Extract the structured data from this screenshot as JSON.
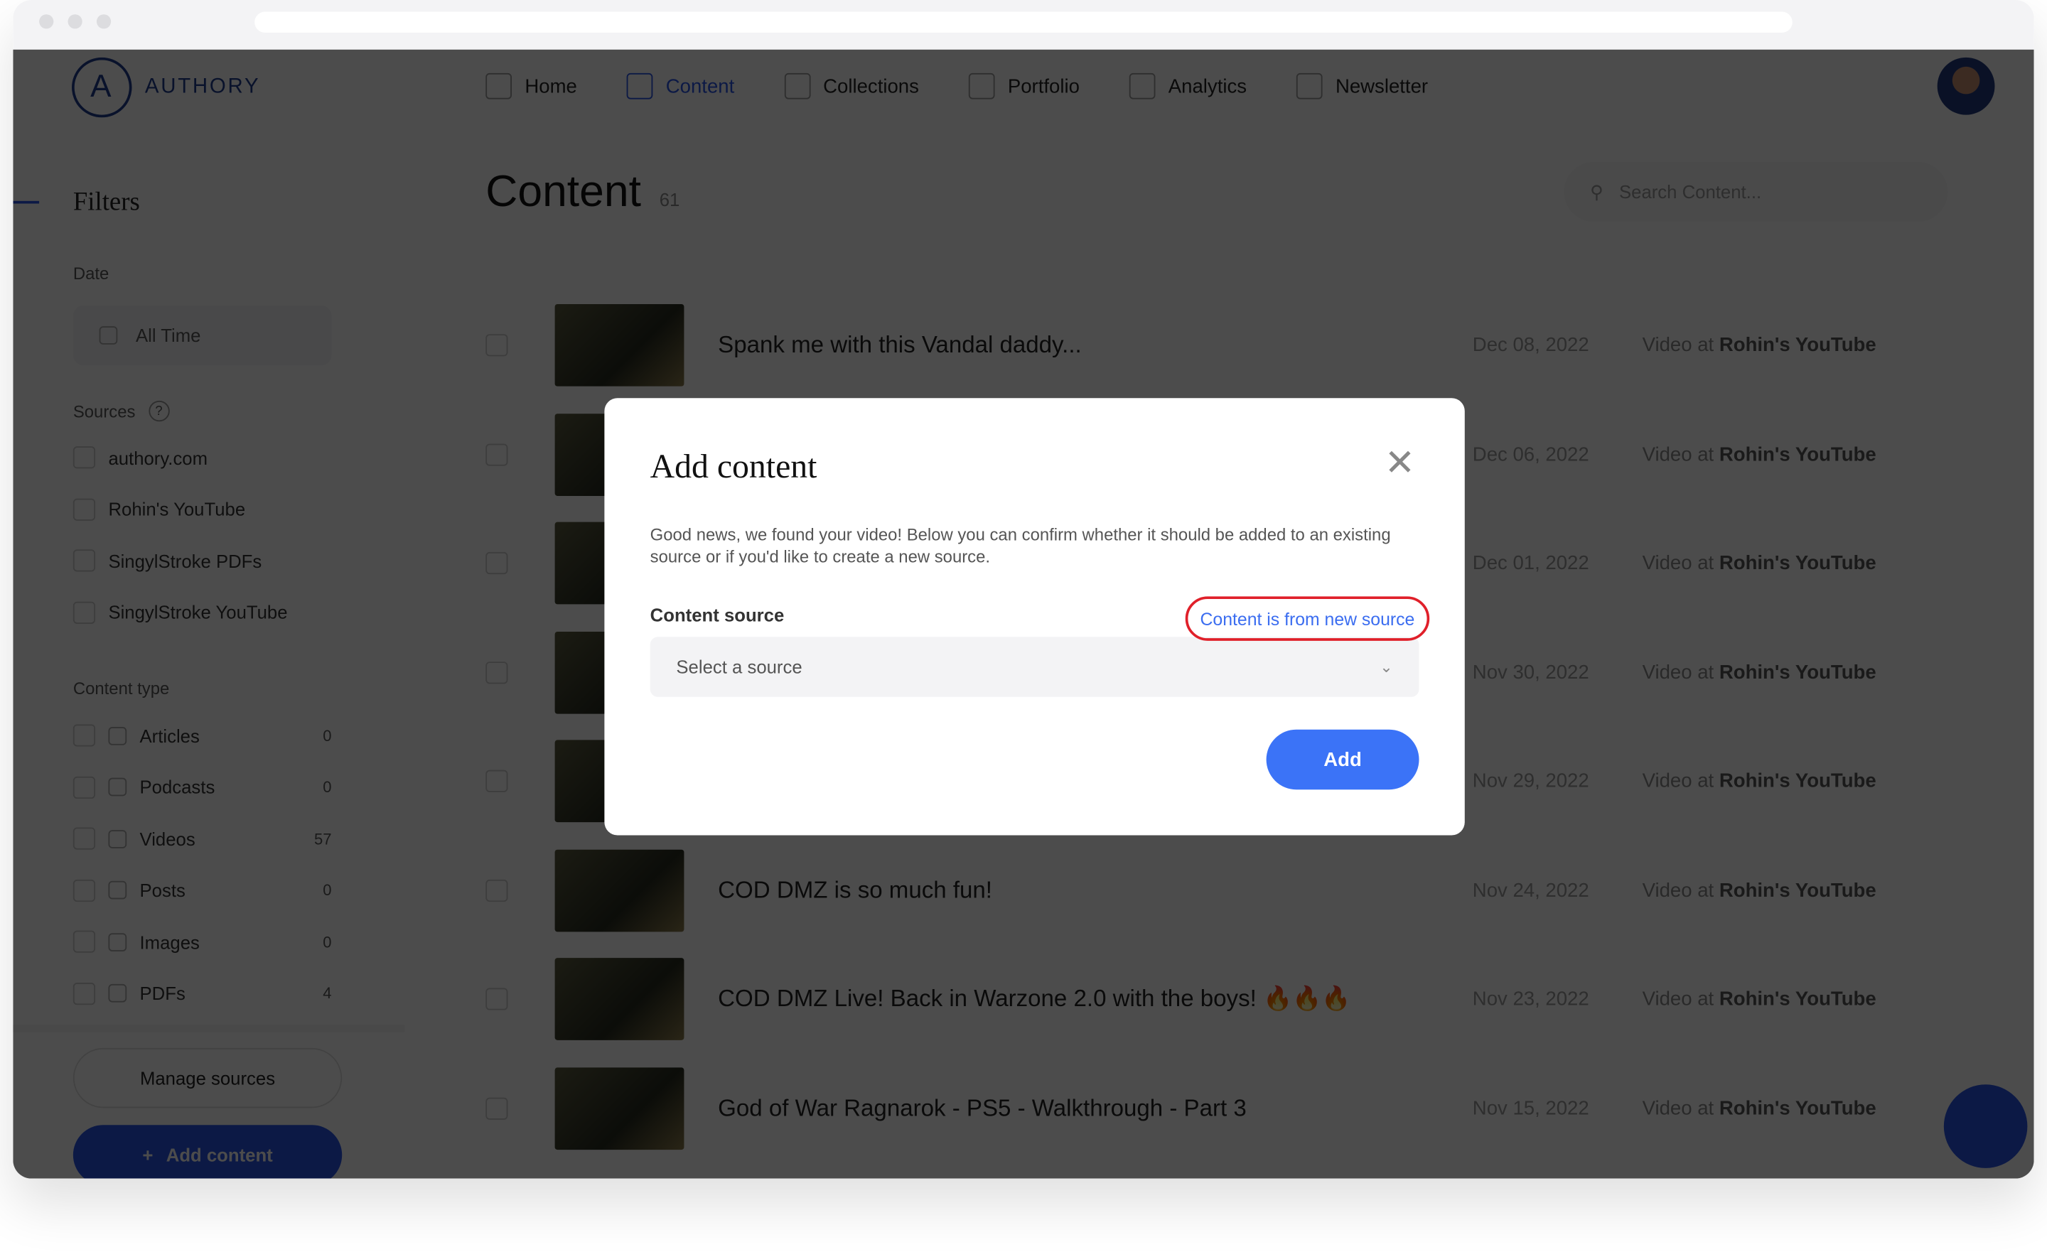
{
  "brand": {
    "name": "AUTHORY",
    "accent": "#2754e6"
  },
  "nav": [
    {
      "label": "Home",
      "icon": "home-icon"
    },
    {
      "label": "Content",
      "icon": "content-icon",
      "active": true
    },
    {
      "label": "Collections",
      "icon": "collections-icon"
    },
    {
      "label": "Portfolio",
      "icon": "portfolio-icon"
    },
    {
      "label": "Analytics",
      "icon": "analytics-icon"
    },
    {
      "label": "Newsletter",
      "icon": "mail-icon"
    }
  ],
  "sidebar": {
    "title": "Filters",
    "date_label": "Date",
    "date_value": "All Time",
    "sources_label": "Sources",
    "sources": [
      "authory.com",
      "Rohin's YouTube",
      "SingylStroke PDFs",
      "SingylStroke YouTube"
    ],
    "type_label": "Content type",
    "types": [
      {
        "label": "Articles",
        "count": "0"
      },
      {
        "label": "Podcasts",
        "count": "0"
      },
      {
        "label": "Videos",
        "count": "57"
      },
      {
        "label": "Posts",
        "count": "0"
      },
      {
        "label": "Images",
        "count": "0"
      },
      {
        "label": "PDFs",
        "count": "4"
      }
    ],
    "manage_label": "Manage sources",
    "add_label": "Add content"
  },
  "main": {
    "title": "Content",
    "count": "61",
    "search_placeholder": "Search Content...",
    "rows": [
      {
        "title": "Spank me with this Vandal daddy...",
        "date": "Dec 08, 2022",
        "prefix": "Video at",
        "source": "Rohin's YouTube"
      },
      {
        "title": "",
        "date": "Dec 06, 2022",
        "prefix": "Video at",
        "source": "Rohin's YouTube"
      },
      {
        "title": "",
        "date": "Dec 01, 2022",
        "prefix": "Video at",
        "source": "Rohin's YouTube"
      },
      {
        "title": "",
        "date": "Nov 30, 2022",
        "prefix": "Video at",
        "source": "Rohin's YouTube"
      },
      {
        "title": "",
        "date": "Nov 29, 2022",
        "prefix": "Video at",
        "source": "Rohin's YouTube"
      },
      {
        "title": "COD DMZ is so much fun!",
        "date": "Nov 24, 2022",
        "prefix": "Video at",
        "source": "Rohin's YouTube"
      },
      {
        "title": "COD DMZ Live! Back in Warzone 2.0 with the boys! 🔥🔥🔥",
        "date": "Nov 23, 2022",
        "prefix": "Video at",
        "source": "Rohin's YouTube"
      },
      {
        "title": "God of War Ragnarok - PS5 - Walkthrough - Part 3",
        "date": "Nov 15, 2022",
        "prefix": "Video at",
        "source": "Rohin's YouTube"
      }
    ]
  },
  "modal": {
    "title": "Add content",
    "description": "Good news, we found your video! Below you can confirm whether it should be added to an existing source or if you'd like to create a new source.",
    "source_label": "Content source",
    "new_source_link": "Content is from new source",
    "select_placeholder": "Select a source",
    "add_button": "Add",
    "highlight_color": "#e0202a",
    "button_color": "#3b73f7"
  }
}
